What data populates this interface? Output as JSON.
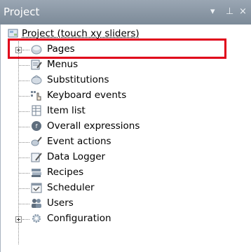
{
  "panel": {
    "title": "Project",
    "controls": {
      "dropdown": "▾",
      "pin": "⊥",
      "close": "×"
    }
  },
  "tree": {
    "root": {
      "label": "Project (touch xy sliders)",
      "icon": "project-icon"
    },
    "items": [
      {
        "label": "Pages",
        "icon": "pages-icon",
        "expandable": true,
        "highlighted": true
      },
      {
        "label": "Menus",
        "icon": "menus-icon"
      },
      {
        "label": "Substitutions",
        "icon": "substitutions-icon"
      },
      {
        "label": "Keyboard events",
        "icon": "keyboard-events-icon"
      },
      {
        "label": "Item list",
        "icon": "item-list-icon"
      },
      {
        "label": "Overall expressions",
        "icon": "overall-expressions-icon"
      },
      {
        "label": "Event actions",
        "icon": "event-actions-icon"
      },
      {
        "label": "Data Logger",
        "icon": "data-logger-icon"
      },
      {
        "label": "Recipes",
        "icon": "recipes-icon"
      },
      {
        "label": "Scheduler",
        "icon": "scheduler-icon"
      },
      {
        "label": "Users",
        "icon": "users-icon"
      },
      {
        "label": "Configuration",
        "icon": "configuration-icon",
        "expandable": true
      }
    ]
  },
  "colors": {
    "titlebar": "#8a97a5",
    "highlight": "#e0001a"
  }
}
